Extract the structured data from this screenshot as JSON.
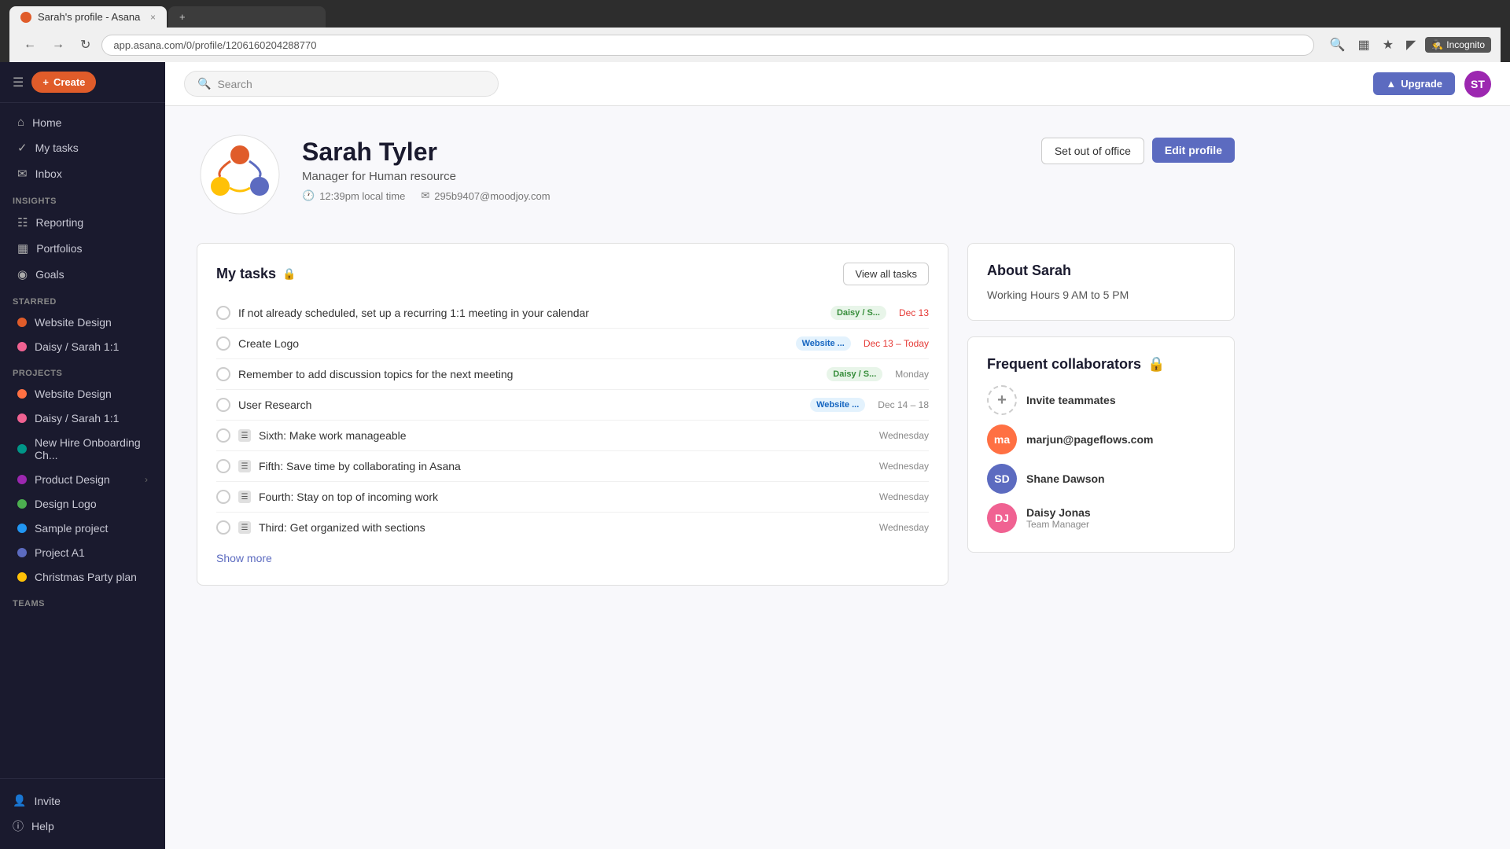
{
  "browser": {
    "tab_title": "Sarah's profile - Asana",
    "tab_icon": "asana-icon",
    "url": "app.asana.com/0/profile/1206160204288770",
    "new_tab_label": "+",
    "close_label": "×",
    "incognito_label": "Incognito"
  },
  "topbar": {
    "menu_icon": "☰",
    "create_label": "Create",
    "search_placeholder": "Search",
    "upgrade_label": "Upgrade",
    "avatar_initials": "ST"
  },
  "sidebar": {
    "home_label": "Home",
    "my_tasks_label": "My tasks",
    "inbox_label": "Inbox",
    "insights_label": "Insights",
    "reporting_label": "Reporting",
    "portfolios_label": "Portfolios",
    "goals_label": "Goals",
    "starred_label": "Starred",
    "starred_items": [
      {
        "label": "Website Design",
        "color": "dot-red"
      },
      {
        "label": "Daisy / Sarah 1:1",
        "color": "dot-pink"
      }
    ],
    "projects_label": "Projects",
    "project_items": [
      {
        "label": "Website Design",
        "color": "dot-orange"
      },
      {
        "label": "Daisy / Sarah 1:1",
        "color": "dot-pink"
      },
      {
        "label": "New Hire Onboarding Ch...",
        "color": "dot-teal"
      },
      {
        "label": "Product Design",
        "color": "dot-purple",
        "has_chevron": true
      },
      {
        "label": "Design Logo",
        "color": "dot-green"
      },
      {
        "label": "Sample project",
        "color": "dot-blue"
      },
      {
        "label": "Project A1",
        "color": "dot-indigo"
      },
      {
        "label": "Christmas Party plan",
        "color": "dot-yellow"
      }
    ],
    "teams_label": "Teams",
    "invite_label": "Invite",
    "help_label": "Help"
  },
  "profile": {
    "name": "Sarah Tyler",
    "role": "Manager for Human resource",
    "local_time": "12:39pm local time",
    "email": "295b9407@moodjoy.com",
    "set_out_office_label": "Set out of office",
    "edit_profile_label": "Edit profile"
  },
  "my_tasks": {
    "title": "My tasks",
    "lock_icon": "🔒",
    "view_all_label": "View all tasks",
    "tasks": [
      {
        "name": "If not already scheduled, set up a recurring 1:1 meeting in your calendar",
        "tag": "Daisy / S...",
        "tag_class": "tag-daisy",
        "date": "Dec 13",
        "date_class": "date-red",
        "type": null
      },
      {
        "name": "Create Logo",
        "tag": "Website ...",
        "tag_class": "tag-website",
        "date": "Dec 13 – Today",
        "date_class": "date-red",
        "type": null
      },
      {
        "name": "Remember to add discussion topics for the next meeting",
        "tag": "Daisy / S...",
        "tag_class": "tag-daisy",
        "date": "Monday",
        "date_class": "",
        "type": null
      },
      {
        "name": "User Research",
        "tag": "Website ...",
        "tag_class": "tag-website",
        "date": "Dec 14 – 18",
        "date_class": "",
        "type": null
      },
      {
        "name": "Sixth: Make work manageable",
        "tag": null,
        "tag_class": "",
        "date": "Wednesday",
        "date_class": "",
        "type": "list"
      },
      {
        "name": "Fifth: Save time by collaborating in Asana",
        "tag": null,
        "tag_class": "",
        "date": "Wednesday",
        "date_class": "",
        "type": "list"
      },
      {
        "name": "Fourth: Stay on top of incoming work",
        "tag": null,
        "tag_class": "",
        "date": "Wednesday",
        "date_class": "",
        "type": "list"
      },
      {
        "name": "Third: Get organized with sections",
        "tag": null,
        "tag_class": "",
        "date": "Wednesday",
        "date_class": "",
        "type": "list"
      }
    ],
    "show_more_label": "Show more"
  },
  "about": {
    "title": "About Sarah",
    "working_hours_label": "Working Hours 9 AM to 5 PM"
  },
  "collaborators": {
    "title": "Frequent collaborators",
    "lock_icon": "🔒",
    "invite_label": "Invite teammates",
    "items": [
      {
        "initials": "ma",
        "name": "marjun@pageflows.com",
        "subtitle": "",
        "color": "#ff7043"
      },
      {
        "initials": "SD",
        "name": "Shane Dawson",
        "subtitle": "",
        "color": "#5c6bc0"
      },
      {
        "initials": "DJ",
        "name": "Daisy Jonas",
        "subtitle": "Team Manager",
        "color": "#f06292"
      }
    ]
  }
}
